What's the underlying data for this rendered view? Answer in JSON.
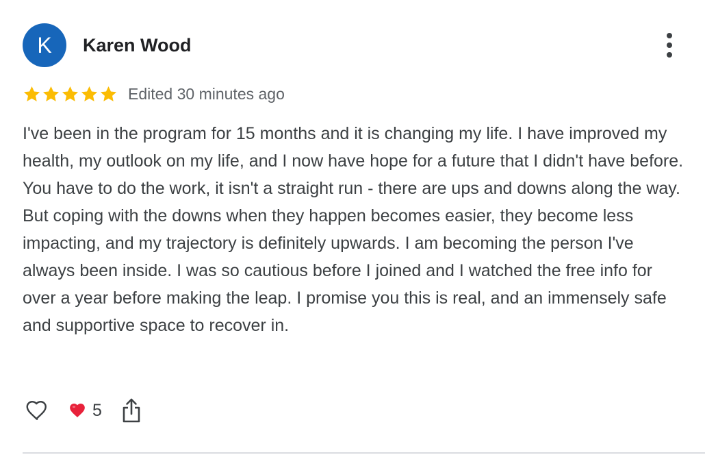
{
  "review": {
    "author_initial": "K",
    "author_name": "Karen Wood",
    "avatar_color": "#1766ba",
    "rating": 5,
    "star_color": "#fbbc04",
    "timestamp": "Edited 30 minutes ago",
    "body": "I've been in the program for 15 months and it is changing my life. I have improved my health, my outlook on my life, and I now have hope for a future that I didn't have before. You have to do the work, it isn't a straight run - there are ups and downs along the way. But coping with the downs when they happen becomes easier, they become less impacting, and my trajectory is definitely upwards. I am becoming the person I've always been inside. I was so cautious before I joined and I watched the free info for over a year before making the leap. I promise you this is real, and an immensely safe and supportive space to recover in."
  },
  "actions": {
    "like_icon": "heart-outline-icon",
    "reaction_icon": "red-heart-emoji",
    "reaction_color": "#e8213a",
    "reaction_count": "5",
    "share_icon": "share-icon",
    "more_icon": "more-vertical-icon"
  }
}
